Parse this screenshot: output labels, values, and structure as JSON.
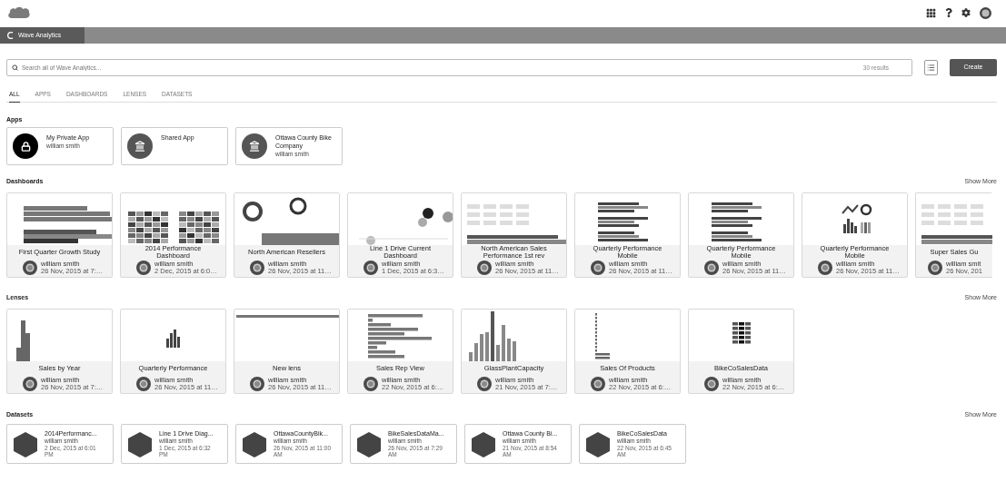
{
  "nav": {
    "app_tab": "Wave Analytics"
  },
  "search": {
    "placeholder": "Search all of Wave Analytics...",
    "results": "30 results"
  },
  "create_button": "Create",
  "tabs": [
    {
      "label": "ALL",
      "selected": true
    },
    {
      "label": "APPS",
      "selected": false
    },
    {
      "label": "DASHBOARDS",
      "selected": false
    },
    {
      "label": "LENSES",
      "selected": false
    },
    {
      "label": "DATASETS",
      "selected": false
    }
  ],
  "apps": {
    "title": "Apps",
    "items": [
      {
        "name": "My Private App",
        "owner": "william smith",
        "kind": "private"
      },
      {
        "name": "Shared App",
        "kind": "shared"
      },
      {
        "name": "Ottawa County Bike Company",
        "owner": "william smith",
        "kind": "shared"
      }
    ]
  },
  "dashboards": {
    "title": "Dashboards",
    "show_more": "Show More",
    "items": [
      {
        "title": "First Quarter Growth Study",
        "owner": "william smith",
        "date": "26 Nov, 2015 at 7:…"
      },
      {
        "title": "2014 Performance Dashboard",
        "owner": "william smith",
        "date": "2 Dec, 2015 at 6:0…"
      },
      {
        "title": "North American Resellers",
        "owner": "william smith",
        "date": "26 Nov, 2015 at 11…"
      },
      {
        "title": "Line 1 Drive Current Dashboard",
        "owner": "william smith",
        "date": "1 Dec, 2015 at 6:3…"
      },
      {
        "title": "North American Sales Performance 1st rev",
        "owner": "william smith",
        "date": "26 Nov, 2015 at 11…"
      },
      {
        "title": "Quarterly Performance Mobile",
        "owner": "william smith",
        "date": "26 Nov, 2015 at 11…"
      },
      {
        "title": "Quarterly Performance Mobile",
        "owner": "william smith",
        "date": "26 Nov, 2015 at 11…"
      },
      {
        "title": "Quarterly Performance Mobile",
        "owner": "william smith",
        "date": "26 Nov, 2015 at 11…"
      },
      {
        "title": "Super Sales Gu",
        "owner": "william smit",
        "date": "26 Nov, 201"
      }
    ]
  },
  "lenses": {
    "title": "Lenses",
    "show_more": "Show More",
    "items": [
      {
        "title": "Sales by Year",
        "owner": "william smith",
        "date": "26 Nov, 2015 at 7:…"
      },
      {
        "title": "Quarterly Performance",
        "owner": "william smith",
        "date": "26 Nov, 2015 at 11…"
      },
      {
        "title": "New lens",
        "owner": "william smith",
        "date": "26 Nov, 2015 at 11…"
      },
      {
        "title": "Sales Rep View",
        "owner": "william smith",
        "date": "22 Nov, 2015 at 6:…"
      },
      {
        "title": "GlassPlantCapacity",
        "owner": "william smith",
        "date": "21 Nov, 2015 at 7:…"
      },
      {
        "title": "Sales Of Products",
        "owner": "william smith",
        "date": "22 Nov, 2015 at 6:…"
      },
      {
        "title": "BikeCoSalesData",
        "owner": "william smith",
        "date": "22 Nov, 2015 at 6:…"
      }
    ]
  },
  "datasets": {
    "title": "Datasets",
    "show_more": "Show More",
    "items": [
      {
        "title": "2014Performanc...",
        "owner": "william smith",
        "date": "2 Dec, 2015 at 6:01 PM"
      },
      {
        "title": "Line 1 Drive Diag...",
        "owner": "william smith",
        "date": "1 Dec, 2015 at 6:32 PM"
      },
      {
        "title": "OttawaCountyBik...",
        "owner": "william smith",
        "date": "26 Nov, 2015 at 11:00 AM"
      },
      {
        "title": "BikeSalesDataMa...",
        "owner": "william smith",
        "date": "26 Nov, 2015 at 7:29 AM"
      },
      {
        "title": "Ottawa County Bi...",
        "owner": "william smith",
        "date": "21 Nov, 2015 at 8:54 AM"
      },
      {
        "title": "BikeCoSalesData",
        "owner": "william smith",
        "date": "22 Nov, 2015 at 6:45 AM"
      }
    ]
  }
}
